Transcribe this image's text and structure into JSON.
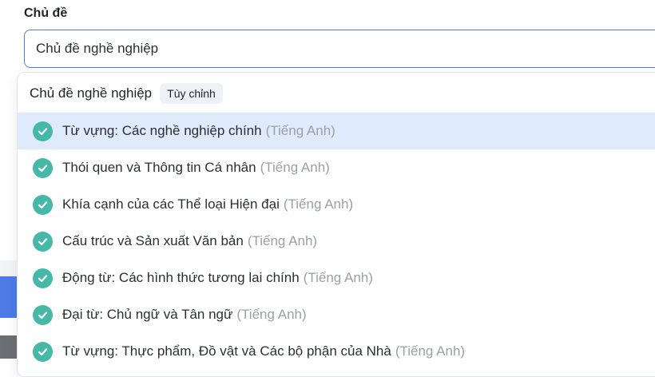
{
  "field": {
    "label": "Chủ đề",
    "value": "Chủ đề nghề nghiệp"
  },
  "dropdown": {
    "group_title": "Chủ đề nghề nghiệp",
    "badge": "Tùy chỉnh",
    "items": [
      {
        "label": "Từ vựng: Các nghề nghiệp chính",
        "lang": "(Tiếng Anh)",
        "selected": true
      },
      {
        "label": "Thói quen và Thông tin Cá nhân",
        "lang": "(Tiếng Anh)",
        "selected": false
      },
      {
        "label": "Khía cạnh của các Thể loại Hiện đại",
        "lang": "(Tiếng Anh)",
        "selected": false
      },
      {
        "label": "Cấu trúc và Sản xuất Văn bản",
        "lang": "(Tiếng Anh)",
        "selected": false
      },
      {
        "label": "Động từ: Các hình thức tương lai chính",
        "lang": "(Tiếng Anh)",
        "selected": false
      },
      {
        "label": "Đại từ: Chủ ngữ và Tân ngữ",
        "lang": "(Tiếng Anh)",
        "selected": false
      },
      {
        "label": "Từ vựng: Thực phẩm, Đồ vật và Các bộ phận của Nhà",
        "lang": "(Tiếng Anh)",
        "selected": false
      }
    ]
  },
  "colors": {
    "check": "#45b8a8",
    "selected_bg": "#dfeafb",
    "input_border": "#4f7bd8"
  },
  "icons": {
    "check": "check-circle-icon"
  }
}
